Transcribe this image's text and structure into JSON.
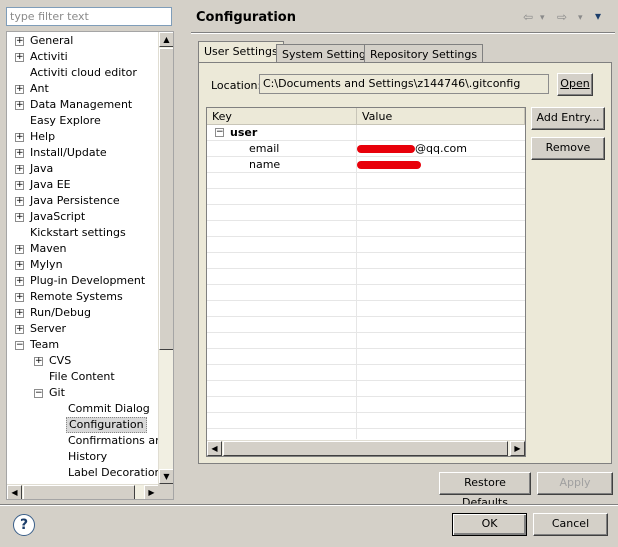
{
  "filter": {
    "placeholder": "type filter text"
  },
  "tree": [
    {
      "label": "General",
      "expander": "+"
    },
    {
      "label": "Activiti",
      "expander": "+"
    },
    {
      "label": "Activiti cloud editor",
      "expander": ""
    },
    {
      "label": "Ant",
      "expander": "+"
    },
    {
      "label": "Data Management",
      "expander": "+"
    },
    {
      "label": "Easy Explore",
      "expander": ""
    },
    {
      "label": "Help",
      "expander": "+"
    },
    {
      "label": "Install/Update",
      "expander": "+"
    },
    {
      "label": "Java",
      "expander": "+"
    },
    {
      "label": "Java EE",
      "expander": "+"
    },
    {
      "label": "Java Persistence",
      "expander": "+"
    },
    {
      "label": "JavaScript",
      "expander": "+"
    },
    {
      "label": "Kickstart settings",
      "expander": ""
    },
    {
      "label": "Maven",
      "expander": "+"
    },
    {
      "label": "Mylyn",
      "expander": "+"
    },
    {
      "label": "Plug-in Development",
      "expander": "+"
    },
    {
      "label": "Remote Systems",
      "expander": "+"
    },
    {
      "label": "Run/Debug",
      "expander": "+"
    },
    {
      "label": "Server",
      "expander": "+"
    },
    {
      "label": "Team",
      "expander": "−"
    },
    {
      "label": "CVS",
      "expander": "+"
    },
    {
      "label": "File Content",
      "expander": ""
    },
    {
      "label": "Git",
      "expander": "−"
    },
    {
      "label": "Commit Dialog",
      "expander": ""
    },
    {
      "label": "Configuration",
      "expander": "",
      "selected": true
    },
    {
      "label": "Confirmations and",
      "expander": ""
    },
    {
      "label": "History",
      "expander": ""
    },
    {
      "label": "Label Decorations",
      "expander": ""
    }
  ],
  "page": {
    "title": "Configuration"
  },
  "nav": {
    "back": "⇦",
    "forward": "⇨",
    "dropdown": "▾",
    "menu": "▾"
  },
  "tabs": [
    "User Settings",
    "System Settings",
    "Repository Settings"
  ],
  "location": {
    "label": "Location:",
    "value": "C:\\Documents and Settings\\z144746\\.gitconfig",
    "open": "Open"
  },
  "table": {
    "headers": [
      "Key",
      "Value"
    ],
    "section": "user",
    "rows": [
      {
        "key": "email",
        "value": "@qq.com"
      },
      {
        "key": "name",
        "value": ""
      }
    ]
  },
  "side_buttons": {
    "add": "Add Entry...",
    "remove": "Remove"
  },
  "page_buttons": {
    "restore": "Restore Defaults",
    "apply": "Apply"
  },
  "dialog_buttons": {
    "ok": "OK",
    "cancel": "Cancel"
  },
  "help": {
    "glyph": "?"
  },
  "colors": {
    "redaction": "#e8000a"
  }
}
